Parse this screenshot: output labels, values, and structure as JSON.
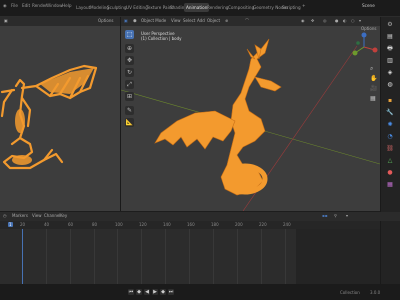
{
  "menus": [
    "File",
    "Edit",
    "Render",
    "Window",
    "Help"
  ],
  "workspaces": [
    "Layout",
    "Modeling",
    "Sculpting",
    "UV Editing",
    "Texture Paint",
    "Shading",
    "Animation",
    "Rendering",
    "Compositing",
    "Geometry Nodes",
    "Scripting"
  ],
  "active_workspace": "Animation",
  "scene_label": "Scene",
  "left_viewport": {
    "options_label": "Options"
  },
  "right_viewport": {
    "mode_label": "Object Mode",
    "header_menus": [
      "View",
      "Select",
      "Add",
      "Object"
    ],
    "overlay_line1": "User Perspective",
    "overlay_line2": "(1) Collection | body",
    "options_label": "Options"
  },
  "timeline": {
    "header_menus": [
      "Markers",
      "View",
      "Channel",
      "Key"
    ],
    "ticks": [
      "0",
      "20",
      "40",
      "60",
      "80",
      "100",
      "120",
      "140",
      "160",
      "180",
      "200",
      "220",
      "240"
    ],
    "current_frame": "1"
  },
  "status": {
    "version": "3.0.0",
    "stats": "Collection"
  },
  "colors": {
    "model": "#f39a2e",
    "accent": "#4772b3",
    "x_axis": "#9b3b3b",
    "y_axis": "#6d8a2d"
  },
  "icons": {
    "select": "select-box-icon",
    "cursor": "cursor-icon",
    "move": "move-icon",
    "rotate": "rotate-icon",
    "scale": "scale-icon",
    "transform": "transform-icon",
    "annotate": "annotate-icon",
    "measure": "measure-icon"
  }
}
